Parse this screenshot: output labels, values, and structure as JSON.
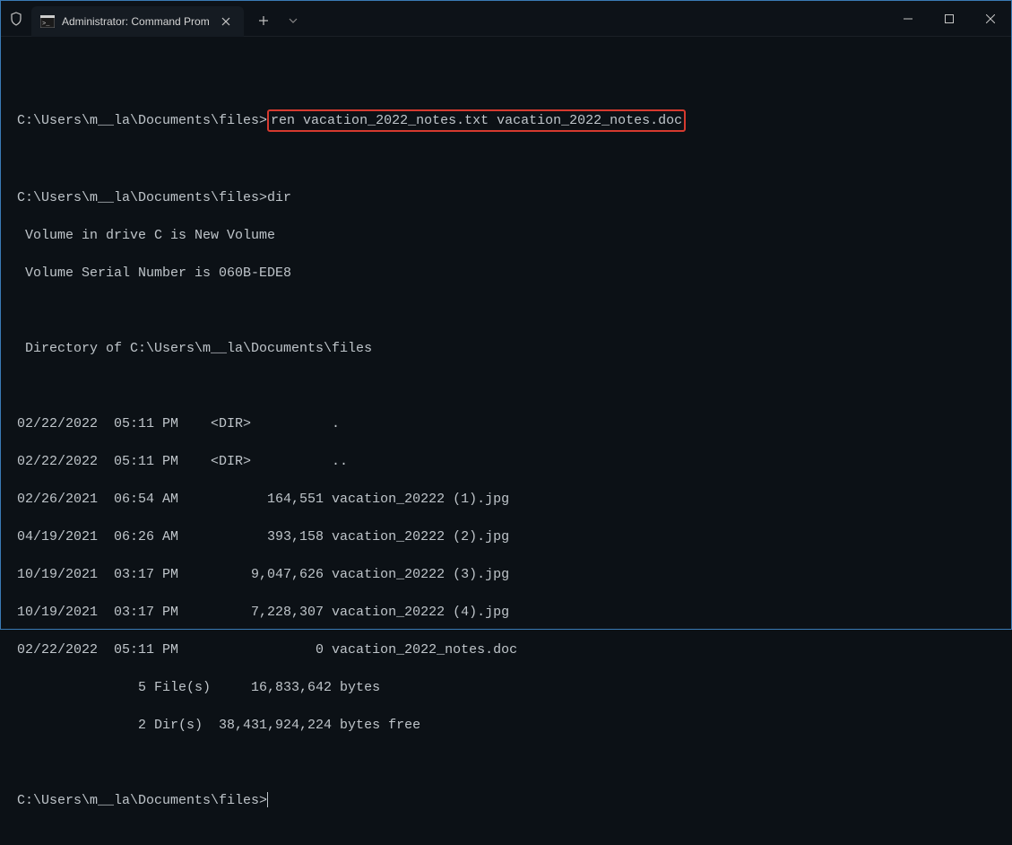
{
  "tab": {
    "title": "Administrator: Command Prom"
  },
  "terminal": {
    "prompt1": "C:\\Users\\m__la\\Documents\\files>",
    "command1": "ren vacation_2022_notes.txt vacation_2022_notes.doc",
    "prompt2": "C:\\Users\\m__la\\Documents\\files>",
    "command2": "dir",
    "volume_line": " Volume in drive C is New Volume",
    "serial_line": " Volume Serial Number is 060B-EDE8",
    "dir_of": " Directory of C:\\Users\\m__la\\Documents\\files",
    "dir_rows": [
      "02/22/2022  05:11 PM    <DIR>          .",
      "02/22/2022  05:11 PM    <DIR>          ..",
      "02/26/2021  06:54 AM           164,551 vacation_20222 (1).jpg",
      "04/19/2021  06:26 AM           393,158 vacation_20222 (2).jpg",
      "10/19/2021  03:17 PM         9,047,626 vacation_20222 (3).jpg",
      "10/19/2021  03:17 PM         7,228,307 vacation_20222 (4).jpg",
      "02/22/2022  05:11 PM                 0 vacation_2022_notes.doc"
    ],
    "summary_files": "               5 File(s)     16,833,642 bytes",
    "summary_dirs": "               2 Dir(s)  38,431,924,224 bytes free",
    "prompt3": "C:\\Users\\m__la\\Documents\\files>"
  }
}
